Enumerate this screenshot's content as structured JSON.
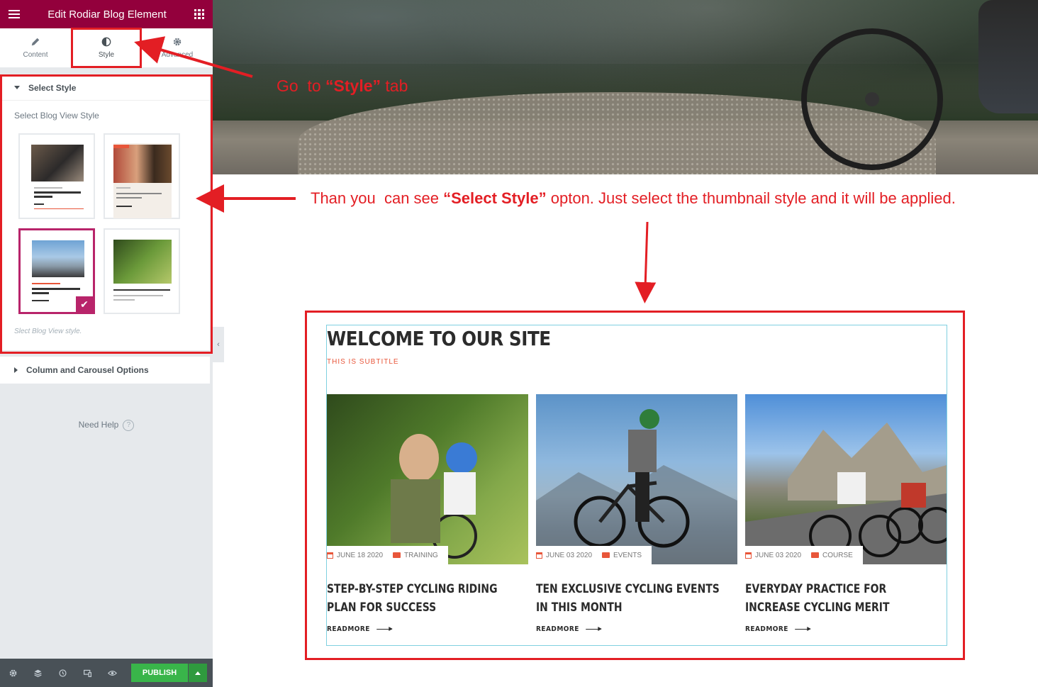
{
  "panel": {
    "title": "Edit Rodiar Blog Element",
    "tabs": [
      {
        "label": "Content",
        "icon": "pencil-icon"
      },
      {
        "label": "Style",
        "icon": "half-circle-icon"
      },
      {
        "label": "Advanced",
        "icon": "gear-icon"
      }
    ],
    "active_tab": "Style",
    "select_style": {
      "heading": "Select Style",
      "control_label": "Select Blog View Style",
      "description": "Slect Blog View style.",
      "selected_index": 2,
      "thumbnails": [
        {
          "caption": "A STEP-BY-STEP BIKE RIDING PLAN FOR SUCCESS"
        },
        {
          "caption": "How can you keep Your Horse Happy and Fit?"
        },
        {
          "caption": "TEN EXCLUSIVE CYCLING EVENTS IN THIS MONTH"
        },
        {
          "caption": "STEP-BY-STEP CYCLING RIDING PLAN"
        }
      ]
    },
    "column_section": "Column and Carousel Options",
    "need_help": "Need Help",
    "help_symbol": "?",
    "publish_label": "PUBLISH",
    "footer_icons": [
      "settings-icon",
      "layers-icon",
      "history-icon",
      "responsive-icon",
      "preview-eye-icon"
    ]
  },
  "annotations": {
    "tab_prefix": "Go  to ",
    "tab_bold": "“Style”",
    "tab_suffix": " tab",
    "select_prefix": "Than you  can see ",
    "select_bold": "“Select Style”",
    "select_suffix": " opton. Just select the thumbnail style and it will be applied.",
    "color": "#e31e24"
  },
  "preview": {
    "title": "WELCOME TO OUR SITE",
    "subtitle": "THIS IS SUBTITLE",
    "read_more": "READMORE",
    "accent": "#e8563a",
    "posts": [
      {
        "date": "JUNE 18 2020",
        "category": "TRAINING",
        "title": "STEP-BY-STEP CYCLING RIDING PLAN FOR SUCCESS"
      },
      {
        "date": "JUNE 03 2020",
        "category": "EVENTS",
        "title": "TEN EXCLUSIVE CYCLING EVENTS IN THIS MONTH"
      },
      {
        "date": "JUNE 03 2020",
        "category": "COURSE",
        "title": "EVERYDAY PRACTICE FOR INCREASE CYCLING MERIT"
      }
    ]
  }
}
